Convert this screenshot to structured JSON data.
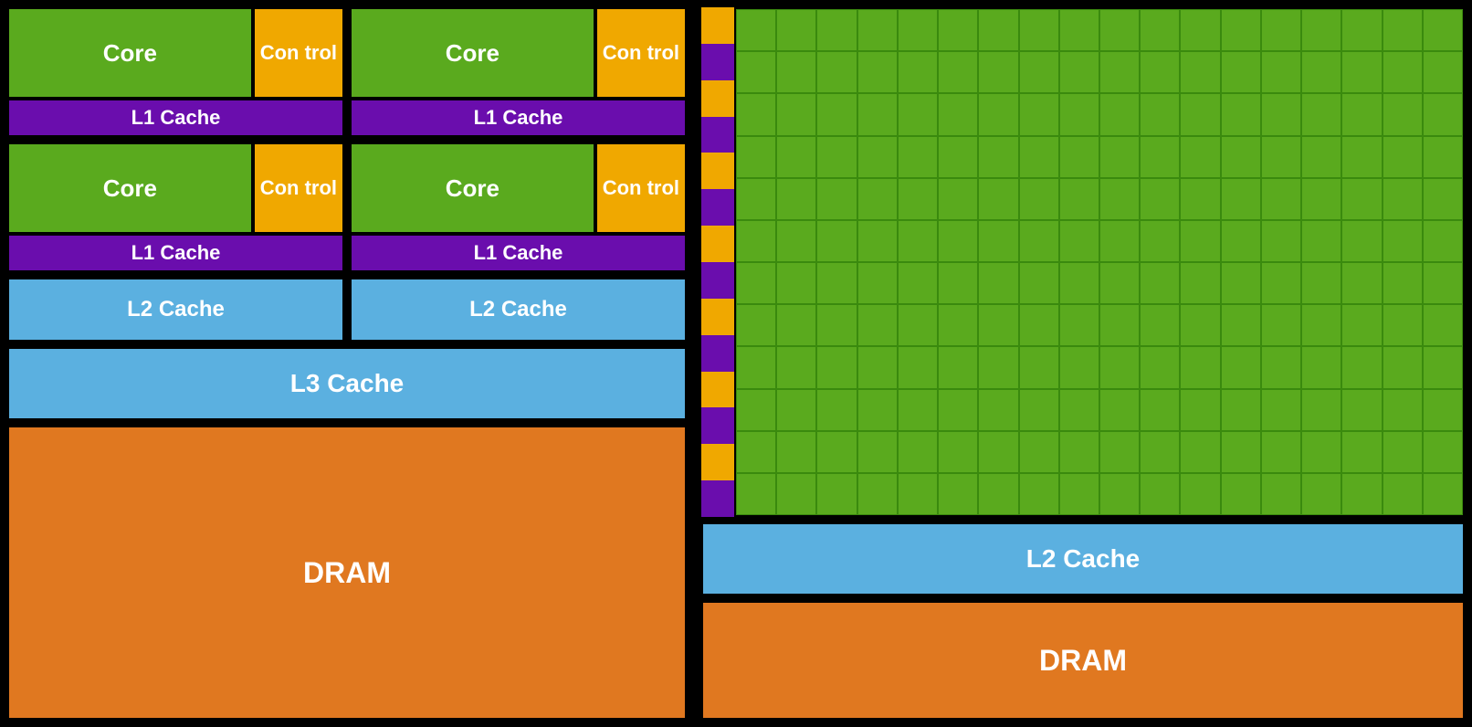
{
  "left": {
    "row1": {
      "cluster1": {
        "core": "Core",
        "control": "Con\ntrol",
        "l1": "L1 Cache"
      },
      "cluster2": {
        "core": "Core",
        "control": "Con\ntrol",
        "l1": "L1 Cache"
      }
    },
    "row2": {
      "cluster1": {
        "core": "Core",
        "control": "Con\ntrol",
        "l1": "L1 Cache"
      },
      "cluster2": {
        "core": "Core",
        "control": "Con\ntrol",
        "l1": "L1 Cache"
      }
    },
    "l2_left": "L2 Cache",
    "l2_right": "L2 Cache",
    "l3": "L3 Cache",
    "dram": "DRAM"
  },
  "right": {
    "l2": "L2 Cache",
    "dram": "DRAM",
    "grid_cols": 18,
    "grid_rows": 12,
    "stripe_segments": 14
  }
}
